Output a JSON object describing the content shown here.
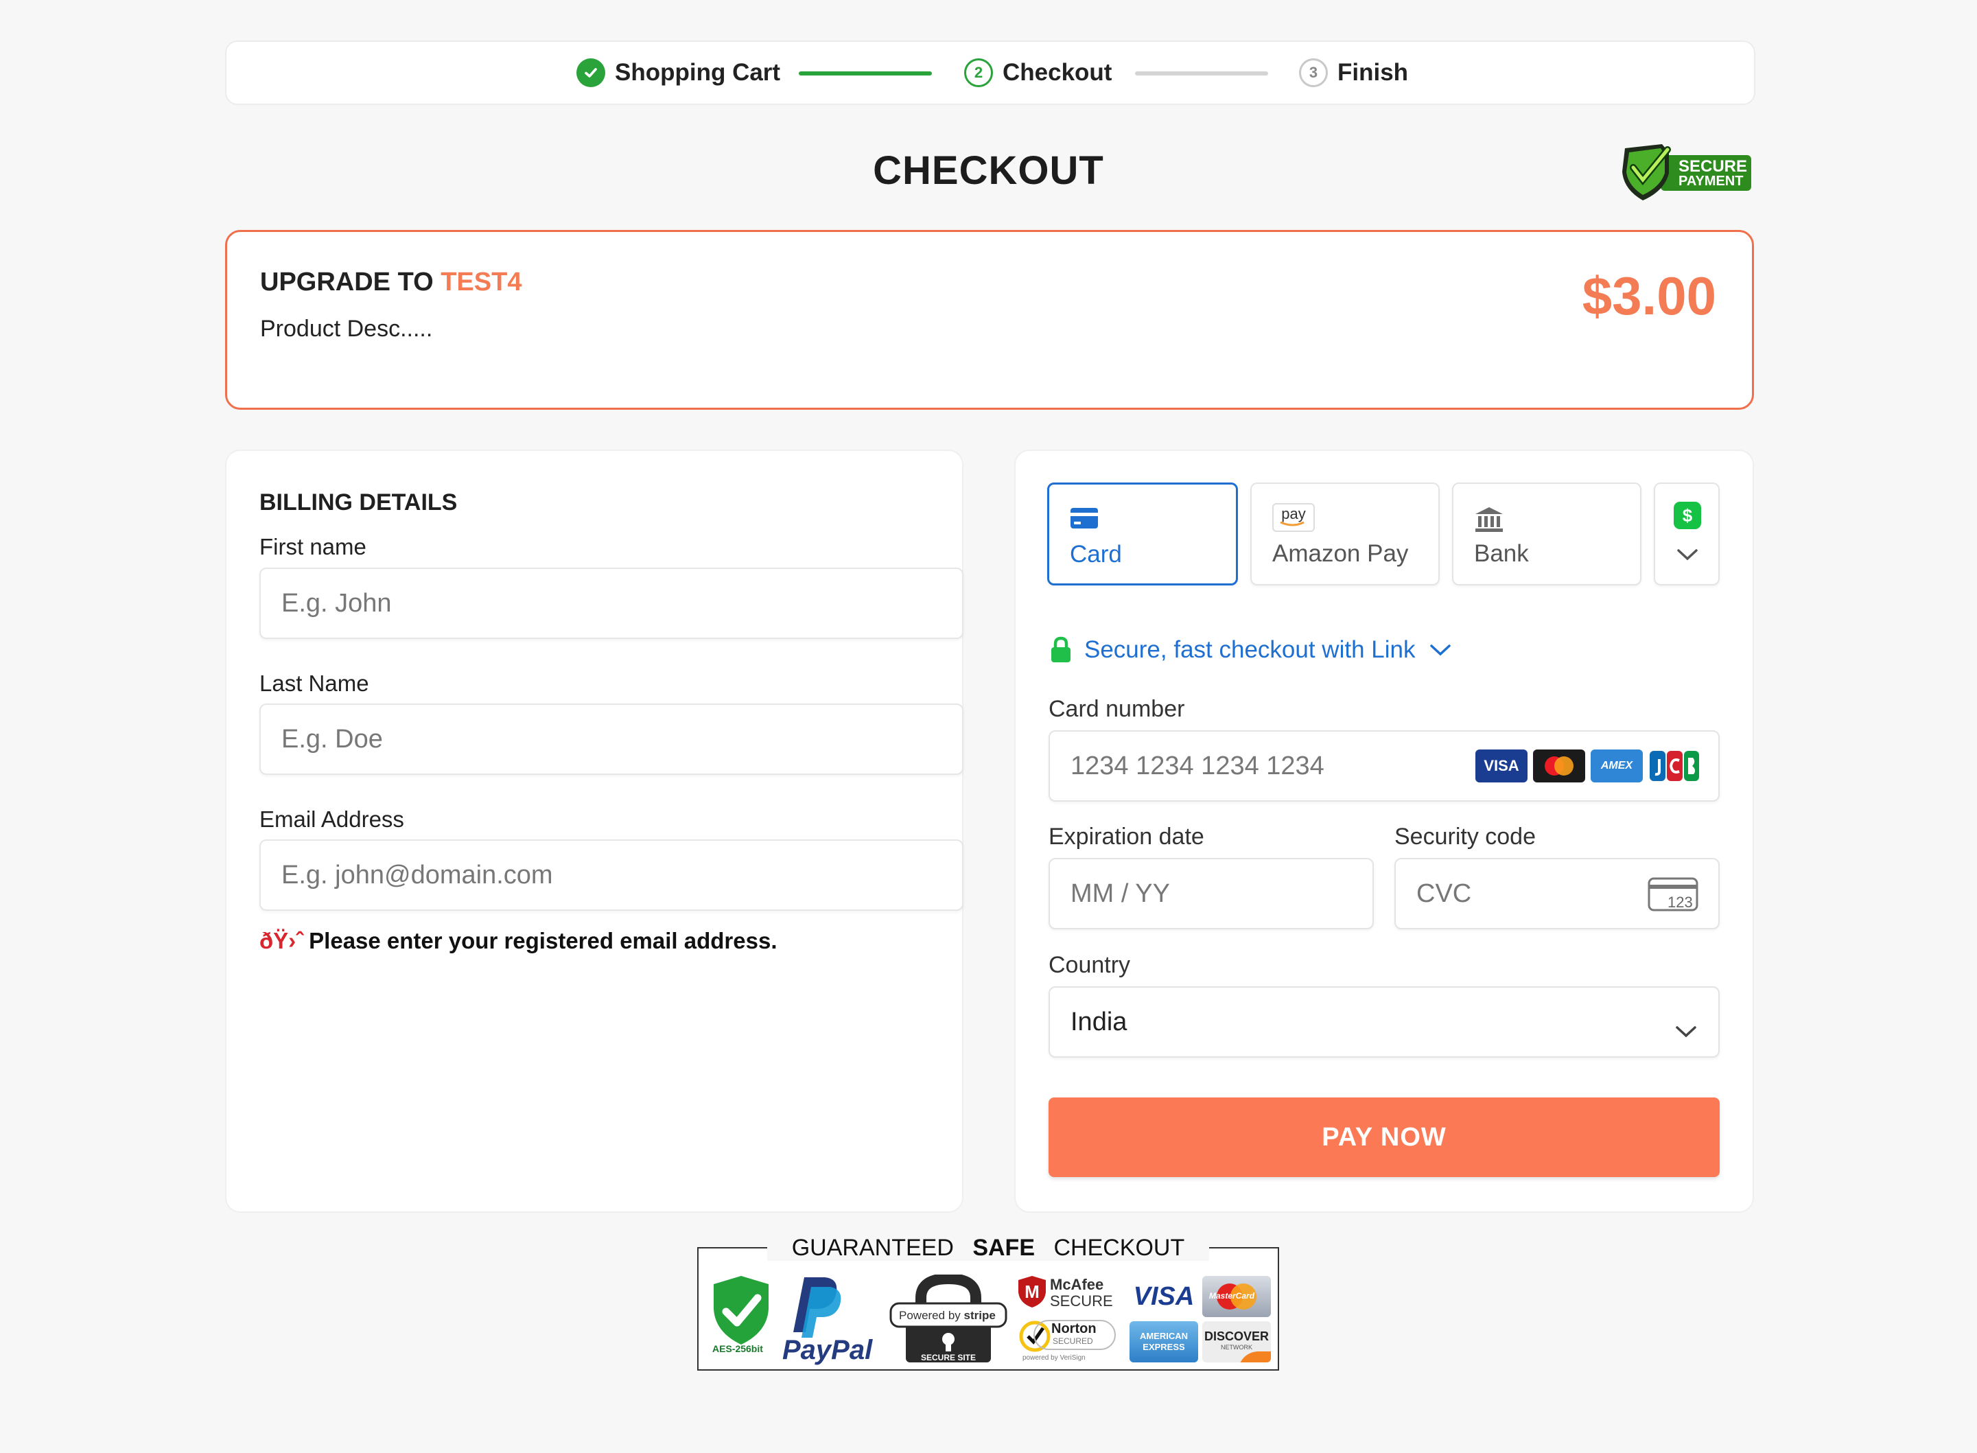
{
  "stepper": {
    "steps": [
      {
        "label": "Shopping Cart",
        "number": "",
        "state": "done"
      },
      {
        "label": "Checkout",
        "number": "2",
        "state": "current"
      },
      {
        "label": "Finish",
        "number": "3",
        "state": "todo"
      }
    ]
  },
  "page": {
    "title": "CHECKOUT",
    "badge": {
      "line1": "SECURE",
      "line2": "PAYMENT"
    }
  },
  "product": {
    "title_prefix": "UPGRADE TO ",
    "title_accent": "TEST4",
    "description": "Product Desc.....",
    "price": "$3.00"
  },
  "billing": {
    "title": "BILLING DETAILS",
    "first_name": {
      "label": "First name",
      "placeholder": "E.g. John"
    },
    "last_name": {
      "label": "Last Name",
      "placeholder": "E.g. Doe"
    },
    "email": {
      "label": "Email Address",
      "placeholder": "E.g. john@domain.com"
    },
    "hint_glyph": "ðŸ›ˆ",
    "hint": "Please enter your registered email address."
  },
  "payment": {
    "tabs": [
      {
        "label": "Card",
        "icon": "card-icon",
        "active": true
      },
      {
        "label": "Amazon Pay",
        "icon": "amazon-pay-icon",
        "active": false
      },
      {
        "label": "Bank",
        "icon": "bank-icon",
        "active": false
      }
    ],
    "amazon_pay_mark": "pay",
    "link_text": "Secure, fast checkout with Link",
    "card_number": {
      "label": "Card number",
      "placeholder": "1234 1234 1234 1234"
    },
    "brands": [
      "VISA",
      "AMEX"
    ],
    "expiry": {
      "label": "Expiration date",
      "placeholder": "MM / YY"
    },
    "cvc": {
      "label": "Security code",
      "placeholder": "CVC",
      "icon_text": "123"
    },
    "country": {
      "label": "Country",
      "value": "India"
    },
    "pay_button": "PAY NOW",
    "accent_color": "#1f6fd1",
    "pay_color": "#fb7a55"
  },
  "guarantee": {
    "title_pre": "GUARANTEED ",
    "title_bold": "SAFE",
    "title_post": " CHECKOUT",
    "aes": "AES-256bit",
    "paypal": "PayPal",
    "stripe_powered": "Powered by",
    "stripe_brand": "stripe",
    "stripe_secure": "SECURE SITE",
    "mcafee": "McAfee",
    "mcafee_secure": "SECURE",
    "norton": "Norton",
    "norton_secured": "SECURED",
    "norton_by": "powered by VeriSign",
    "visa": "VISA",
    "mastercard": "MasterCard",
    "amex_line1": "AMERICAN",
    "amex_line2": "EXPRESS",
    "discover": "DISCOVER",
    "discover_sub": "NETWORK"
  }
}
